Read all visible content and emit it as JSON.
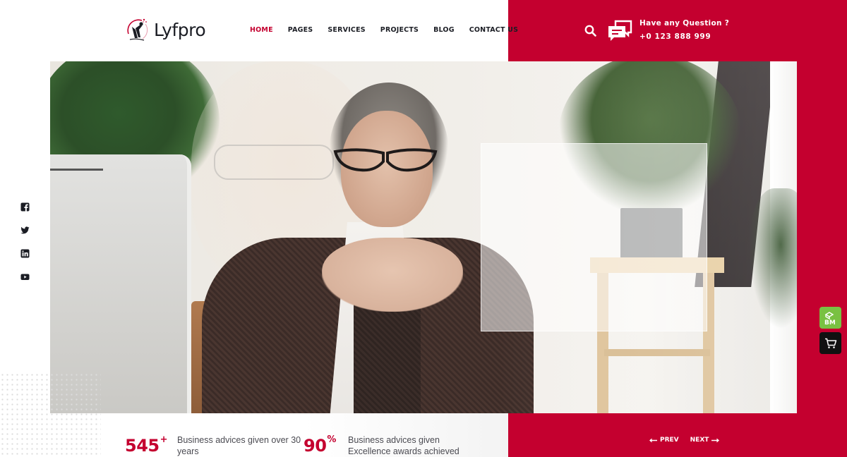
{
  "brand": {
    "name": "Lyfpro",
    "accent_color": "#c4002f",
    "logo_icon": "runner-with-stars-logo"
  },
  "nav": {
    "items": [
      {
        "label": "HOME",
        "active": true
      },
      {
        "label": "PAGES",
        "active": false
      },
      {
        "label": "SERVICES",
        "active": false
      },
      {
        "label": "PROJECTS",
        "active": false
      },
      {
        "label": "BLOG",
        "active": false
      },
      {
        "label": "CONTACT US",
        "active": false
      }
    ]
  },
  "header_contact": {
    "search_icon": "search-icon",
    "chat_icon": "chat-bubbles-icon",
    "question": "Have any Question ?",
    "phone": "+0 123 888 999"
  },
  "social": [
    {
      "name": "facebook",
      "icon": "facebook-icon"
    },
    {
      "name": "twitter",
      "icon": "twitter-icon"
    },
    {
      "name": "linkedin",
      "icon": "linkedin-icon"
    },
    {
      "name": "youtube",
      "icon": "youtube-icon"
    }
  ],
  "hero": {
    "image_alt": "Senior businesswoman with glasses sitting at desk with hands clasped"
  },
  "stats": [
    {
      "value": "545",
      "suffix": "+",
      "text_line1": "Business advices given over 30",
      "text_line2": "years"
    },
    {
      "value": "90",
      "suffix": "%",
      "text_line1": "Business advices given",
      "text_line2": "Excellence awards achieved"
    }
  ],
  "pager": {
    "prev_label": "PREV",
    "next_label": "NEXT"
  },
  "floating": {
    "builder_icon": "page-builder-icon",
    "cart_icon": "cart-icon"
  }
}
